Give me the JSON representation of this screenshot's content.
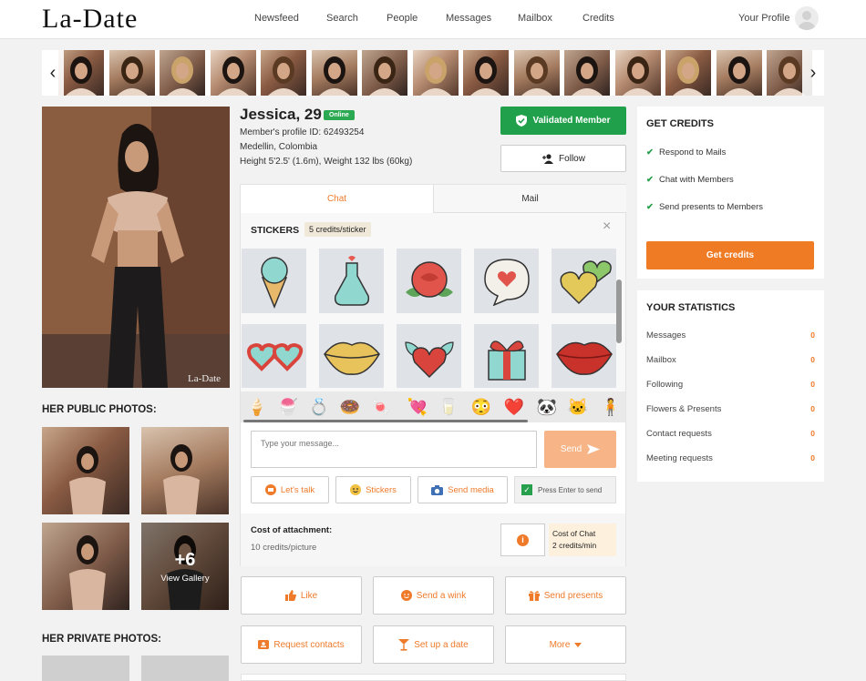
{
  "header": {
    "logo": "La-Date",
    "nav": [
      "Newsfeed",
      "Search",
      "People",
      "Messages",
      "Mailbox",
      "Credits"
    ],
    "profile_link": "Your Profile"
  },
  "strip": {
    "prev_icon": "‹",
    "next_icon": "›",
    "thumb_count": 15
  },
  "photo": {
    "watermark": "La-Date"
  },
  "profile": {
    "name": "Jessica, 29",
    "status": "Online",
    "member_id": "Member's profile ID: 62493254",
    "location": "Medellin, Colombia",
    "stats": "Height 5'2.5' (1.6m), Weight 132 lbs (60kg)",
    "validated": "Validated Member",
    "follow": "Follow"
  },
  "chat": {
    "tabs": [
      "Chat",
      "Mail"
    ],
    "stickers_label": "STICKERS",
    "stickers_price": "5 credits/sticker",
    "close_icon": "×",
    "message_placeholder": "Type your message...",
    "send_label": "Send",
    "tools": [
      "Let's talk",
      "Stickers",
      "Send media"
    ],
    "press_enter": "Press Enter to send",
    "cost_label": "Cost of attachment:",
    "cost_value": "10 credits/picture",
    "info_icon": "i",
    "cost_chat_line1": "Cost of Chat",
    "cost_chat_line2": "2 credits/min"
  },
  "stickers": [
    "ice-cream",
    "potion",
    "rose",
    "heart-bubble",
    "hearts",
    "heart-glasses",
    "lips-gold",
    "winged-heart",
    "gift",
    "lips-red"
  ],
  "emojis": [
    "🍦",
    "🍧",
    "💍",
    "🍩",
    "🍬",
    "💘",
    "🥛",
    "😳",
    "❤️",
    "🐼",
    "🐱",
    "🧍"
  ],
  "actions": {
    "row1": [
      "Like",
      "Send a wink",
      "Send presents"
    ],
    "row2": [
      "Request contacts",
      "Set up a date",
      "More"
    ]
  },
  "left": {
    "public_photos": "HER PUBLIC PHOTOS:",
    "gallery_more": "+6",
    "view_gallery": "View Gallery",
    "private_photos": "HER PRIVATE PHOTOS:"
  },
  "credits": {
    "title": "GET CREDITS",
    "items": [
      "Respond to Mails",
      "Chat with Members",
      "Send presents to Members"
    ],
    "button": "Get credits"
  },
  "statistics": {
    "title": "YOUR STATISTICS",
    "rows": [
      {
        "label": "Messages",
        "value": "0"
      },
      {
        "label": "Mailbox",
        "value": "0"
      },
      {
        "label": "Following",
        "value": "0"
      },
      {
        "label": "Flowers & Presents",
        "value": "0"
      },
      {
        "label": "Contact requests",
        "value": "0"
      },
      {
        "label": "Meeting requests",
        "value": "0"
      }
    ]
  },
  "colors": {
    "accent": "#ee7a2a",
    "validated_green": "#21a04b",
    "online_green": "#2aa952"
  }
}
